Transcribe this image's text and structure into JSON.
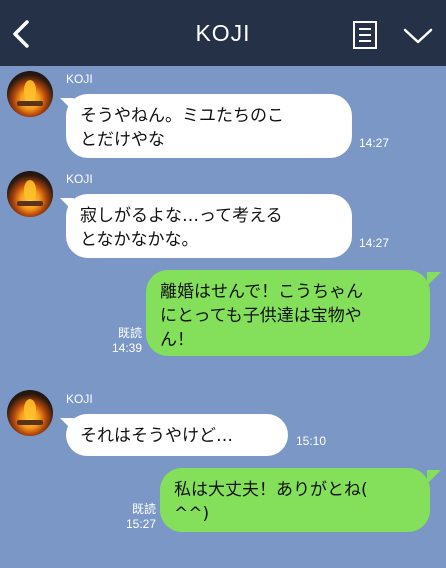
{
  "header": {
    "title": "KOJI",
    "back_icon": "chevron-left-icon",
    "notes_icon": "notes-icon",
    "menu_icon": "chevron-down-icon"
  },
  "colors": {
    "header_bg": "#243146",
    "chat_bg": "#7b97c6",
    "incoming_bubble": "#ffffff",
    "outgoing_bubble": "#84e05a"
  },
  "messages": [
    {
      "direction": "incoming",
      "sender": "KOJI",
      "lines": [
        "そうやねん。ミユたちのこ",
        "とだけやな"
      ],
      "time": "14:27"
    },
    {
      "direction": "incoming",
      "sender": "KOJI",
      "lines": [
        "寂しがるよな…って考える",
        "となかなかな。"
      ],
      "time": "14:27"
    },
    {
      "direction": "outgoing",
      "lines": [
        "離婚はせんで！こうちゃん",
        "にとっても子供達は宝物や",
        "ん！"
      ],
      "read": "既読",
      "time": "14:39"
    },
    {
      "direction": "incoming",
      "sender": "KOJI",
      "lines": [
        "それはそうやけど…"
      ],
      "time": "15:10"
    },
    {
      "direction": "outgoing",
      "lines": [
        "私は大丈夫！ありがとね(",
        "^^)"
      ],
      "read": "既読",
      "time": "15:27"
    }
  ]
}
